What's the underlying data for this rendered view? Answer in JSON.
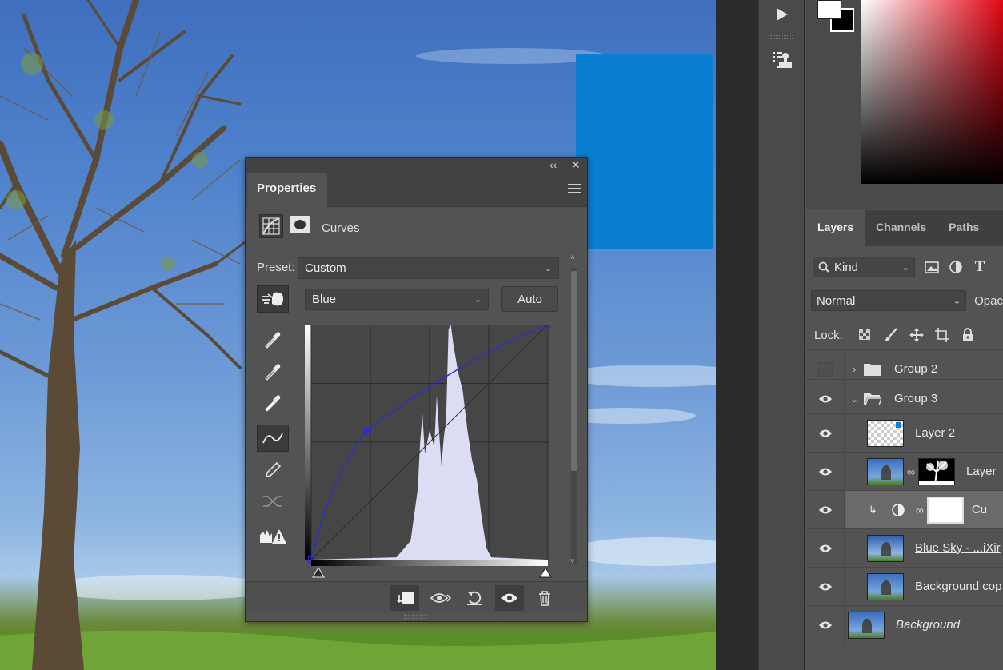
{
  "colors": {
    "accent_blue": "#0a7ed1",
    "curve_blue": "#2b2bd6",
    "histogram": "#dcdcf5"
  },
  "strip": {
    "play_icon": "play-icon",
    "stamp_icon": "clone-source-icon"
  },
  "properties": {
    "tab_label": "Properties",
    "adjustment_name": "Curves",
    "preset_label": "Preset:",
    "preset_value": "Custom",
    "channel_value": "Blue",
    "auto_label": "Auto"
  },
  "layers_panel": {
    "tabs": [
      "Layers",
      "Channels",
      "Paths"
    ],
    "filter_kind": "Kind",
    "blend_mode": "Normal",
    "opacity_label": "Opac",
    "lock_label": "Lock:",
    "rows": [
      {
        "name": "Group 2"
      },
      {
        "name": "Group 3"
      },
      {
        "name": "Layer 2"
      },
      {
        "name": "Layer"
      },
      {
        "name": "Cu"
      },
      {
        "name": "Blue Sky - ...iXir"
      },
      {
        "name": "Background cop"
      },
      {
        "name": "Background"
      }
    ]
  },
  "curve": {
    "input_range": [
      0,
      255
    ],
    "points": [
      [
        0,
        0
      ],
      [
        60,
        140
      ],
      [
        255,
        255
      ]
    ]
  }
}
